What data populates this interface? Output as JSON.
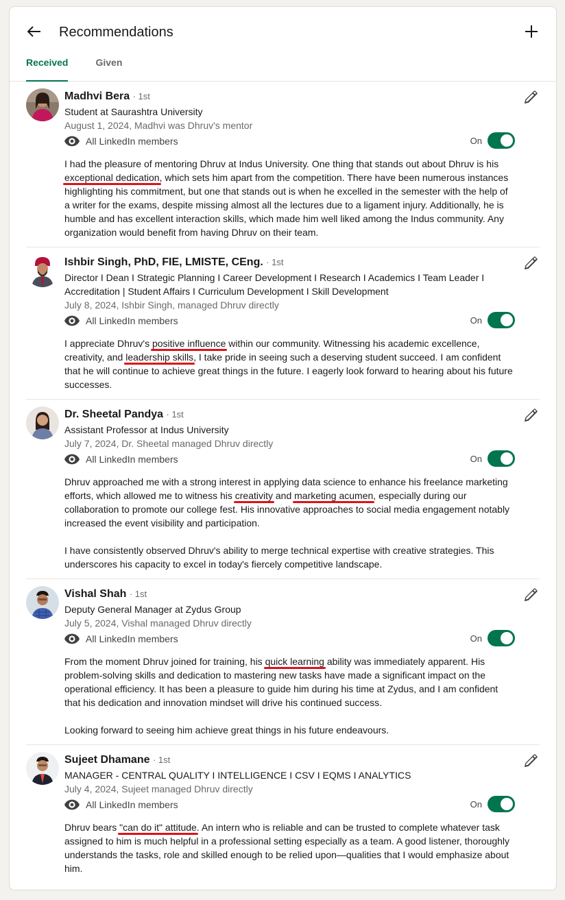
{
  "header": {
    "title": "Recommendations"
  },
  "tabs": [
    {
      "label": "Received",
      "active": true
    },
    {
      "label": "Given",
      "active": false
    }
  ],
  "accent_color": "#01754f",
  "recommendations": [
    {
      "name": "Madhvi Bera",
      "degree": "· 1st",
      "headline": "Student at Saurashtra University",
      "meta": "August 1, 2024, Madhvi was Dhruv's mentor",
      "visibility": "All LinkedIn members",
      "toggle": "On",
      "paragraphs": [
        [
          "I had the pleasure of mentoring Dhruv at Indus University. One thing that stands out about Dhruv is his ",
          "exceptional dedication",
          ", which sets him apart from the competition. There have been numerous instances highlighting his commitment, but one that stands out is when he excelled in the semester with the help of a writer for the exams, despite missing almost all the lectures due to a ligament injury. Additionally, he is humble and has excellent interaction skills, which made him well liked among the Indus community. Any organization would benefit from having Dhruv on their team."
        ]
      ]
    },
    {
      "name": "Ishbir Singh, PhD, FIE, LMISTE, CEng.",
      "degree": "· 1st",
      "headline": "Director I Dean I Strategic Planning I Career Development I Research I Academics I Team Leader I Accreditation | Student Affairs I Curriculum Development I Skill Development",
      "meta": "July 8, 2024, Ishbir Singh, managed Dhruv directly",
      "visibility": "All LinkedIn members",
      "toggle": "On",
      "paragraphs": [
        [
          "I appreciate Dhruv's ",
          "positive influence",
          " within our community. Witnessing his academic excellence, creativity, and ",
          "leadership skills",
          ", I take pride in seeing such a deserving student succeed. I am confident that he will continue to achieve great things in the future. I eagerly look forward to hearing about his future successes."
        ]
      ]
    },
    {
      "name": "Dr. Sheetal Pandya",
      "degree": "· 1st",
      "headline": "Assistant Professor at Indus University",
      "meta": "July 7, 2024, Dr. Sheetal managed Dhruv directly",
      "visibility": "All LinkedIn members",
      "toggle": "On",
      "paragraphs": [
        [
          "Dhruv approached me with a strong interest in applying data science to enhance his freelance marketing efforts, which allowed me to witness his ",
          "creativity",
          " and ",
          "marketing acumen",
          ", especially during our collaboration to promote our college fest. His innovative approaches to social media engagement notably increased the event visibility and participation."
        ],
        [
          "I have consistently observed Dhruv's ability to merge technical expertise with creative strategies. This underscores his capacity to excel in today's fiercely competitive landscape."
        ]
      ]
    },
    {
      "name": "Vishal Shah",
      "degree": "· 1st",
      "headline": "Deputy General Manager at Zydus Group",
      "meta": "July 5, 2024, Vishal managed Dhruv directly",
      "visibility": "All LinkedIn members",
      "toggle": "On",
      "paragraphs": [
        [
          "From the moment Dhruv joined for training, his ",
          "quick learning",
          " ability was immediately apparent. His problem-solving skills and dedication to mastering new tasks have made a significant impact on the operational efficiency. It has been a pleasure to guide him during his time at Zydus, and I am confident that his dedication and innovation mindset will drive his continued success."
        ],
        [
          "Looking forward to seeing him achieve great things in his future endeavours."
        ]
      ]
    },
    {
      "name": "Sujeet Dhamane",
      "degree": "· 1st",
      "headline": "MANAGER - CENTRAL QUALITY I INTELLIGENCE I CSV I EQMS I ANALYTICS",
      "meta": "July 4, 2024, Sujeet managed Dhruv directly",
      "visibility": "All LinkedIn members",
      "toggle": "On",
      "paragraphs": [
        [
          "Dhruv bears ",
          "\"can do it\" attitude",
          ". An intern who is reliable and can be trusted to complete whatever task assigned to him is much helpful in a professional setting especially as a team. A good listener, thoroughly understands the tasks, role and skilled enough to be relied upon—qualities that I would emphasize about him."
        ]
      ]
    }
  ]
}
